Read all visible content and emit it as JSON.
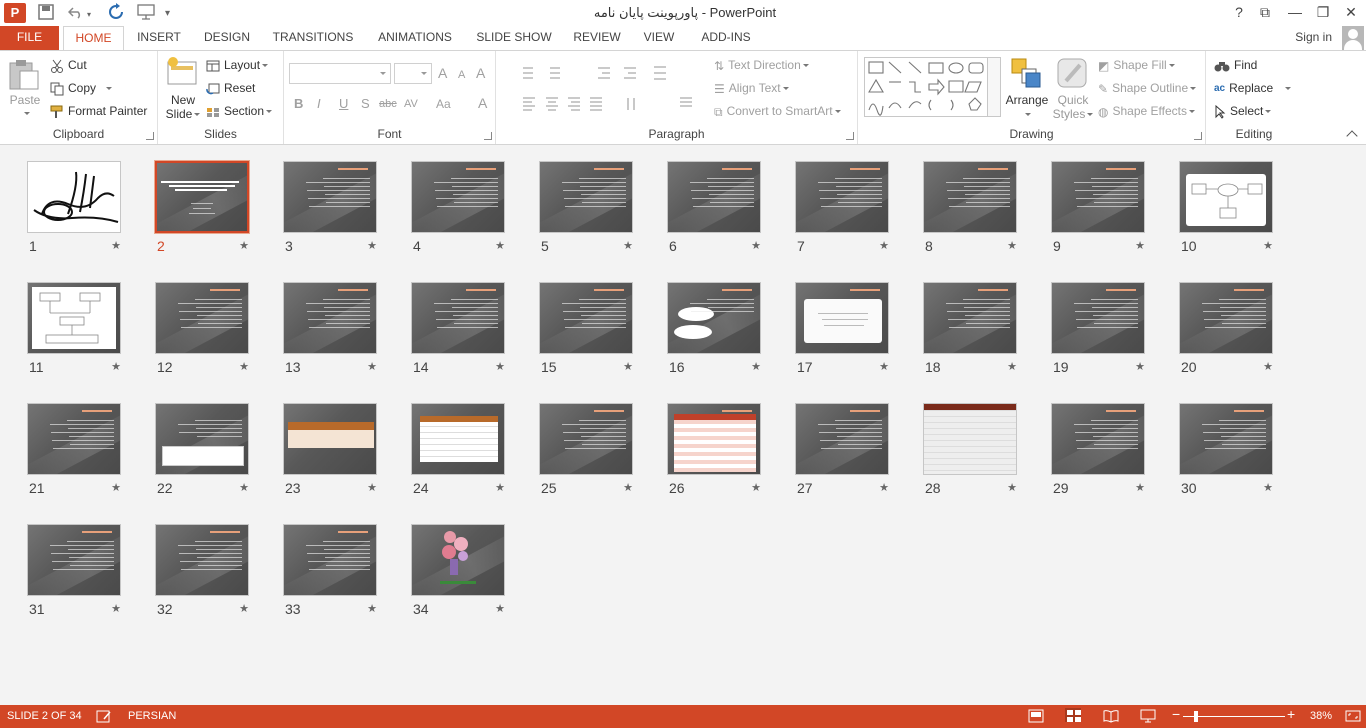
{
  "titlebar": {
    "title": "پاورپوینت پایان نامه - PowerPoint",
    "help": "?",
    "restore": "⧉",
    "minimize": "—",
    "maximize": "❐",
    "close": "✕"
  },
  "tabs": [
    "FILE",
    "HOME",
    "INSERT",
    "DESIGN",
    "TRANSITIONS",
    "ANIMATIONS",
    "SLIDE SHOW",
    "REVIEW",
    "VIEW",
    "ADD-INS"
  ],
  "account": {
    "signin": "Sign in"
  },
  "ribbon": {
    "clipboard": {
      "label": "Clipboard",
      "paste": "Paste",
      "cut": "Cut",
      "copy": "Copy",
      "format_painter": "Format Painter"
    },
    "slides": {
      "label": "Slides",
      "new_slide_1": "New",
      "new_slide_2": "Slide",
      "layout": "Layout",
      "reset": "Reset",
      "section": "Section"
    },
    "font": {
      "label": "Font",
      "grow": "A",
      "shrink": "A",
      "clear": "A",
      "bold": "B",
      "italic": "I",
      "underline": "U",
      "shadow": "S",
      "strike": "abc",
      "spacing": "AV",
      "case": "Aa",
      "color": "A"
    },
    "paragraph": {
      "label": "Paragraph",
      "text_direction": "Text Direction",
      "align_text": "Align Text",
      "smartart": "Convert to SmartArt"
    },
    "drawing": {
      "label": "Drawing",
      "arrange": "Arrange",
      "quick_styles_1": "Quick",
      "quick_styles_2": "Styles",
      "shape_fill": "Shape Fill",
      "shape_outline": "Shape Outline",
      "shape_effects": "Shape Effects"
    },
    "editing": {
      "label": "Editing",
      "find": "Find",
      "replace": "Replace",
      "select": "Select"
    }
  },
  "slides": [
    {
      "n": "1",
      "kind": "white"
    },
    {
      "n": "2",
      "kind": "title",
      "selected": true
    },
    {
      "n": "3",
      "kind": "text"
    },
    {
      "n": "4",
      "kind": "text"
    },
    {
      "n": "5",
      "kind": "text"
    },
    {
      "n": "6",
      "kind": "text"
    },
    {
      "n": "7",
      "kind": "text"
    },
    {
      "n": "8",
      "kind": "text"
    },
    {
      "n": "9",
      "kind": "text"
    },
    {
      "n": "10",
      "kind": "diagram"
    },
    {
      "n": "11",
      "kind": "flow"
    },
    {
      "n": "12",
      "kind": "text"
    },
    {
      "n": "13",
      "kind": "text"
    },
    {
      "n": "14",
      "kind": "text"
    },
    {
      "n": "15",
      "kind": "text"
    },
    {
      "n": "16",
      "kind": "bubbles"
    },
    {
      "n": "17",
      "kind": "box"
    },
    {
      "n": "18",
      "kind": "text"
    },
    {
      "n": "19",
      "kind": "text"
    },
    {
      "n": "20",
      "kind": "text"
    },
    {
      "n": "21",
      "kind": "text"
    },
    {
      "n": "22",
      "kind": "chartbox"
    },
    {
      "n": "23",
      "kind": "table"
    },
    {
      "n": "24",
      "kind": "table2"
    },
    {
      "n": "25",
      "kind": "text"
    },
    {
      "n": "26",
      "kind": "redtable"
    },
    {
      "n": "27",
      "kind": "text"
    },
    {
      "n": "28",
      "kind": "bigtable"
    },
    {
      "n": "29",
      "kind": "text"
    },
    {
      "n": "30",
      "kind": "text"
    },
    {
      "n": "31",
      "kind": "text"
    },
    {
      "n": "32",
      "kind": "text"
    },
    {
      "n": "33",
      "kind": "text"
    },
    {
      "n": "34",
      "kind": "flowers"
    }
  ],
  "statusbar": {
    "slide_info": "SLIDE 2 OF 34",
    "language": "PERSIAN",
    "zoom": "38%",
    "minus": "−",
    "plus": "+"
  },
  "colors": {
    "accent": "#d24726"
  }
}
